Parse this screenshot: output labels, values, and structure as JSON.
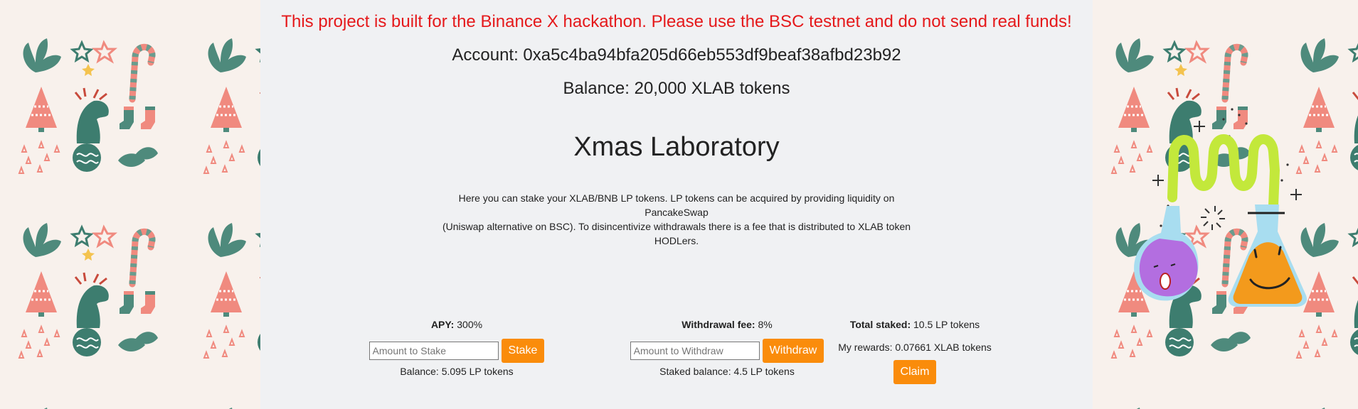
{
  "notice": "This project is built for the Binance X hackathon. Please use the BSC testnet and do not send real funds!",
  "account": "Account: 0xa5c4ba94bfa205d66eb553df9beaf38afbd23b92",
  "balance": "Balance: 20,000 XLAB tokens",
  "title": "Xmas Laboratory",
  "description_line1": "Here you can stake your XLAB/BNB LP tokens. LP tokens can be acquired by providing liquidity on PancakeSwap",
  "description_line2": "(Uniswap alternative on BSC). To disincentivize withdrawals there is a fee that is distributed to XLAB token HODLers.",
  "stake": {
    "label": "APY:",
    "value": "300%",
    "placeholder": "Amount to Stake",
    "button": "Stake",
    "balance": "Balance: 5.095 LP tokens"
  },
  "withdraw": {
    "label": "Withdrawal fee:",
    "value": "8%",
    "placeholder": "Amount to Withdraw",
    "button": "Withdraw",
    "balance": "Staked balance: 4.5 LP tokens"
  },
  "rewards": {
    "label": "Total staked:",
    "value": "10.5 LP tokens",
    "my_rewards": "My rewards: 0.07661 XLAB tokens",
    "button": "Claim"
  },
  "colors": {
    "accent": "#fa8c0b",
    "warning": "#e5191b",
    "background": "#f8f1ec",
    "panel": "#f0f1f3"
  }
}
